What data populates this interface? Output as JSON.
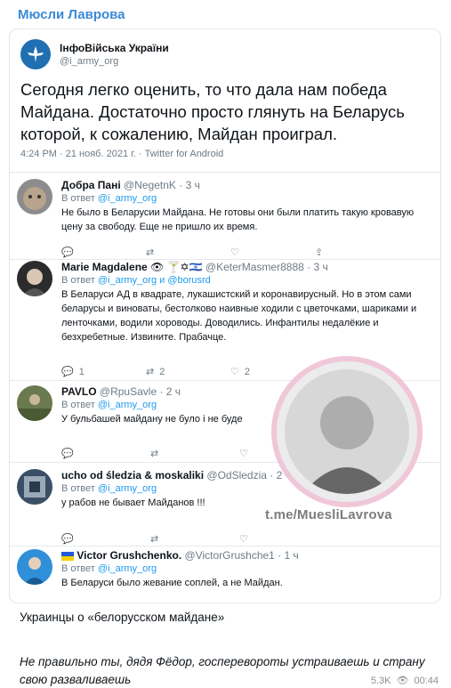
{
  "channel": {
    "name": "Мюсли Лаврова"
  },
  "tweet": {
    "author_name": "ІнфоВійська України",
    "author_handle": "@i_army_org",
    "text": "Сегодня легко оценить, то что дала нам победа Майдана. Достаточно просто глянуть на Беларусь которой, к сожалению, Майдан проиграл.",
    "meta": "4:24 PM · 21 нояб. 2021 г. · Twitter for Android"
  },
  "replies": [
    {
      "name": "Добра Пані",
      "handle": "@NegetnK",
      "time": "· 3 ч",
      "reply_prefix": "В ответ",
      "reply_to": "@i_army_org",
      "text": "Не было в Беларусии Майдана. Не готовы они были  платить такую кровавую цену за свободу. Еще не пришло их время.",
      "actions": {
        "replies": "",
        "retweets": "",
        "likes": ""
      }
    },
    {
      "name": "Marie Magdalene",
      "name_emoji": "👁 🍸✡🇮🇱",
      "handle": "@KeterMasmer8888",
      "time": "· 3 ч",
      "reply_prefix": "В ответ",
      "reply_to": "@i_army_org и @borusrd",
      "text": "В Беларуси АД в квадрате, лукашистский и коронавирусный. Но в этом сами беларусы и виноваты, бестолково наивные ходили с цветочками, шариками и ленточками, водили хороводы. Доводились. Инфантилы недалёкие и безхребетные. Извините. Прабачце.",
      "actions": {
        "replies": "1",
        "retweets": "2",
        "likes": "2"
      }
    },
    {
      "name": "PAVLO",
      "handle": "@RpuSavle",
      "time": "· 2 ч",
      "reply_prefix": "В ответ",
      "reply_to": "@i_army_org",
      "text": "У бульбашей майдану не було і не буде",
      "actions": {
        "replies": "",
        "retweets": "",
        "likes": ""
      }
    },
    {
      "name": "ucho od śledzia & moskaliki",
      "handle": "@OdSledzia",
      "time": "· 2 ч",
      "reply_prefix": "В ответ",
      "reply_to": "@i_army_org",
      "text": "у рабов не бывает Майданов !!!",
      "actions": {
        "replies": "",
        "retweets": "",
        "likes": ""
      }
    },
    {
      "name": "Victor Grushchenko.",
      "handle": "@VictorGrushche1",
      "time": "· 1 ч",
      "reply_prefix": "В ответ",
      "reply_to": "@i_army_org",
      "text": "В Беларуси было жевание соплей, а не Майдан.",
      "actions": {
        "replies": "",
        "retweets": "",
        "likes": ""
      }
    }
  ],
  "watermark": {
    "text": "t.me/MuesliLavrova"
  },
  "post": {
    "caption": "Украинцы о «белорусском майдане»",
    "quote": "Не правильно ты, дядя Фёдор, госперевороты устраиваешь и страну свою разваливаешь",
    "views": "5.3K",
    "time": "00:44"
  },
  "colors": {
    "accent": "#3a8ad6",
    "link": "#1d9bf0",
    "muted": "#6e7b86"
  }
}
